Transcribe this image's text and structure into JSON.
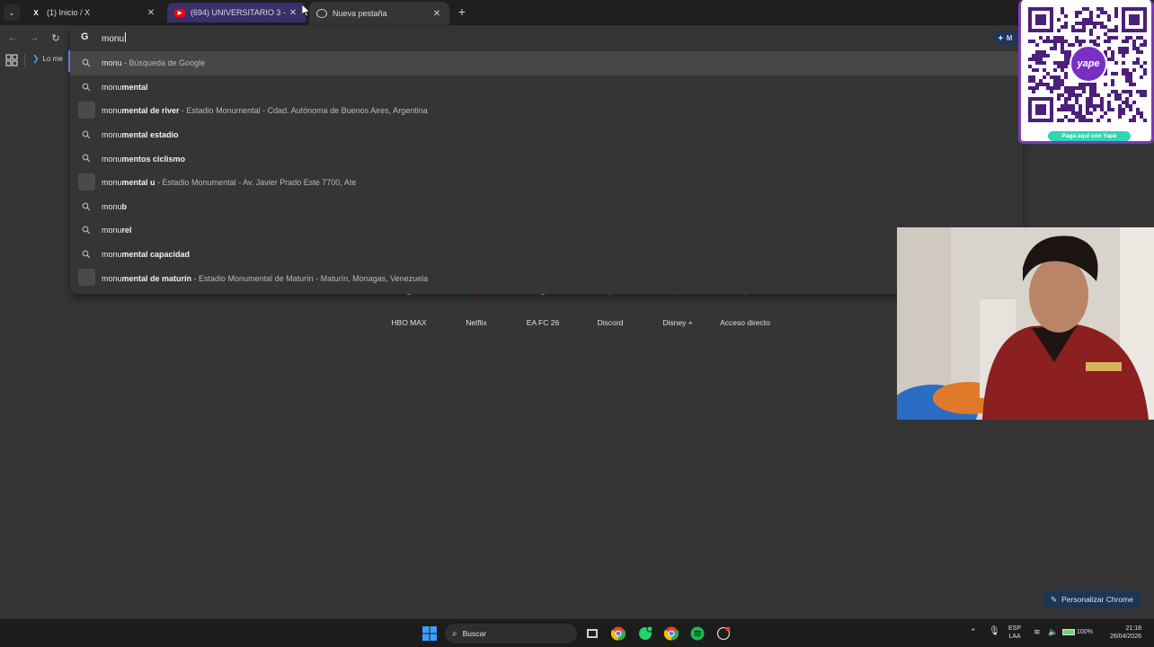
{
  "tabs": [
    {
      "title": "(1) Inicio / X",
      "favicon": "x-logo-icon"
    },
    {
      "title": "(694) UNIVERSITARIO 3 - 0 U. C",
      "favicon": "youtube-icon"
    },
    {
      "title": "Nueva pestaña",
      "favicon": "chrome-icon"
    }
  ],
  "bookmarks": {
    "item_label": "Lo me"
  },
  "omnibox": {
    "typed_text": "monu",
    "suggestions": [
      {
        "typed": "monu",
        "completion": "",
        "sub": " - Búsqueda de Google",
        "icon": "search-icon"
      },
      {
        "typed": "monu",
        "completion": "mental",
        "sub": "",
        "icon": "search-icon"
      },
      {
        "typed": "monu",
        "completion": "mental de river",
        "sub": " - Estadio Monumental - Cdad. Autónoma de Buenos Aires, Argentina",
        "icon": "thumbnail"
      },
      {
        "typed": "monu",
        "completion": "mental estadio",
        "sub": "",
        "icon": "search-icon"
      },
      {
        "typed": "monu",
        "completion": "mentos ciclismo",
        "sub": "",
        "icon": "search-icon"
      },
      {
        "typed": "monu",
        "completion": "mental u",
        "sub": " - Estadio Monumental - Av. Javier Prado Este 7700, Ate",
        "icon": "thumbnail"
      },
      {
        "typed": "monu",
        "completion": "b",
        "sub": "",
        "icon": "search-icon"
      },
      {
        "typed": "monu",
        "completion": "rel",
        "sub": "",
        "icon": "search-icon"
      },
      {
        "typed": "monu",
        "completion": "mental capacidad",
        "sub": "",
        "icon": "search-icon"
      },
      {
        "typed": "monu",
        "completion": "mental de maturín",
        "sub": " - Estadio Monumental de Maturín - Maturín, Monagas, Venezuela",
        "icon": "thumbnail"
      }
    ]
  },
  "shortcuts": [
    {
      "label": "HBO MAX",
      "color": "#cfcfcf"
    },
    {
      "label": "Netflix",
      "color": "#e50914"
    },
    {
      "label": "EA FC 26",
      "color": "#c9d62a"
    },
    {
      "label": "Discord",
      "color": "#e0334a"
    },
    {
      "label": "Disney +",
      "color": "#555555"
    },
    {
      "label": "Acceso directo",
      "color": "#666666"
    }
  ],
  "gemini_label": "M",
  "qr": {
    "brand": "yape",
    "caption": "Paga aquí con Yape"
  },
  "customize_label": "Personalizar Chrome",
  "taskbar": {
    "search_label": "Buscar",
    "language": "ESP",
    "layout": "LAA",
    "battery": "100%",
    "time": "21:18",
    "date": "26/04/2026"
  }
}
